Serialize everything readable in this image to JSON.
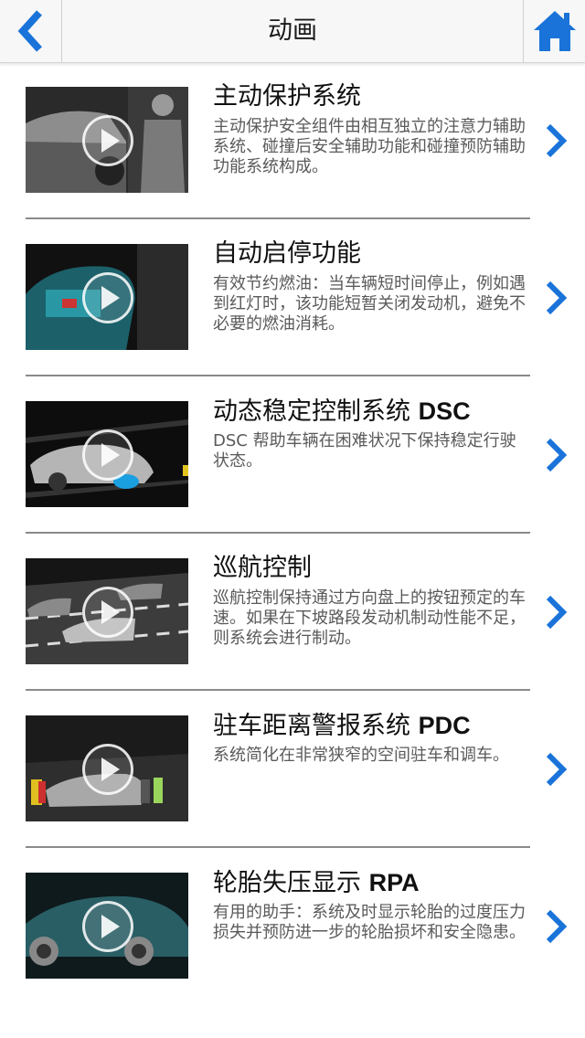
{
  "header": {
    "title": "动画",
    "back_icon": "chevron-left-icon",
    "home_icon": "home-icon",
    "accent_color": "#1a73d9"
  },
  "items": [
    {
      "title": "主动保护系统",
      "desc": "主动保护安全组件由相互独立的注意力辅助系统、碰撞后安全辅助功能和碰撞预防辅助功能系统构成。"
    },
    {
      "title": "自动启停功能",
      "desc": "有效节约燃油：当车辆短时间停止，例如遇到红灯时，该功能短暂关闭发动机，避免不必要的燃油消耗。"
    },
    {
      "title": "动态稳定控制系统 ",
      "title_bold": "DSC",
      "desc": "DSC 帮助车辆在困难状况下保持稳定行驶状态。"
    },
    {
      "title": "巡航控制",
      "desc": "巡航控制保持通过方向盘上的按钮预定的车速。如果在下坡路段发动机制动性能不足，则系统会进行制动。"
    },
    {
      "title": "驻车距离警报系统 ",
      "title_bold": "PDC",
      "desc": "系统简化在非常狭窄的空间驻车和调车。"
    },
    {
      "title": "轮胎失压显示 ",
      "title_bold": "RPA",
      "desc": "有用的助手：系统及时显示轮胎的过度压力损失并预防进一步的轮胎损坏和安全隐患。"
    }
  ]
}
